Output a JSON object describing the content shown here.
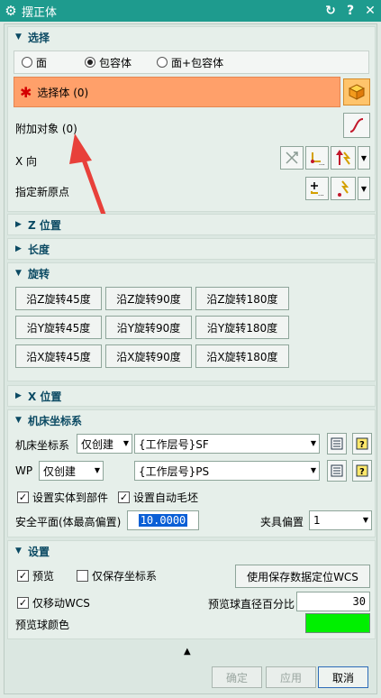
{
  "window": {
    "title": "摆正体",
    "gear_icon": "gear-icon",
    "reset_icon": "reset-icon",
    "help": "?",
    "close": "✕"
  },
  "sections": {
    "select": {
      "title": "选择",
      "radios": [
        {
          "label": "面",
          "checked": false
        },
        {
          "label": "包容体",
          "checked": true
        },
        {
          "label": "面+包容体",
          "checked": false
        }
      ],
      "select_body": "选择体 (0)",
      "extra_objects": "附加对象 (0)",
      "x_dir": "X 向",
      "new_origin": "指定新原点"
    },
    "z_pos": {
      "title": "Z 位置"
    },
    "length": {
      "title": "长度"
    },
    "rotate": {
      "title": "旋转",
      "buttons": [
        [
          "沿Z旋转45度",
          "沿Z旋转90度",
          "沿Z旋转180度"
        ],
        [
          "沿Y旋转45度",
          "沿Y旋转90度",
          "沿Y旋转180度"
        ],
        [
          "沿X旋转45度",
          "沿X旋转90度",
          "沿X旋转180度"
        ]
      ]
    },
    "x_pos": {
      "title": "X 位置"
    },
    "mcs": {
      "title": "机床坐标系",
      "mcs_label": "机床坐标系",
      "mcs_mode": "仅创建",
      "mcs_layer": "{工作层号}SF",
      "wp_label": "WP",
      "wp_mode": "仅创建",
      "wp_layer": "{工作层号}PS",
      "set_solid": "设置实体到部件",
      "set_blank": "设置自动毛坯",
      "safe_plane_label": "安全平面(体最高偏置)",
      "safe_plane_value": "10.0000",
      "fixture_label": "夹具偏置",
      "fixture_value": "1"
    },
    "settings": {
      "title": "设置",
      "preview": "预览",
      "save_only": "仅保存坐标系",
      "use_saved": "使用保存数据定位WCS",
      "move_wcs": "仅移动WCS",
      "ball_pct_label": "预览球直径百分比",
      "ball_pct_value": "30",
      "ball_color_label": "预览球颜色",
      "ball_color": "#00f000"
    }
  },
  "footer": {
    "ok": "确定",
    "apply": "应用",
    "cancel": "取消"
  },
  "colors": {
    "title_bar": "#1e9b8e",
    "selection": "#ffa06a",
    "arrow": "#e8403a"
  }
}
